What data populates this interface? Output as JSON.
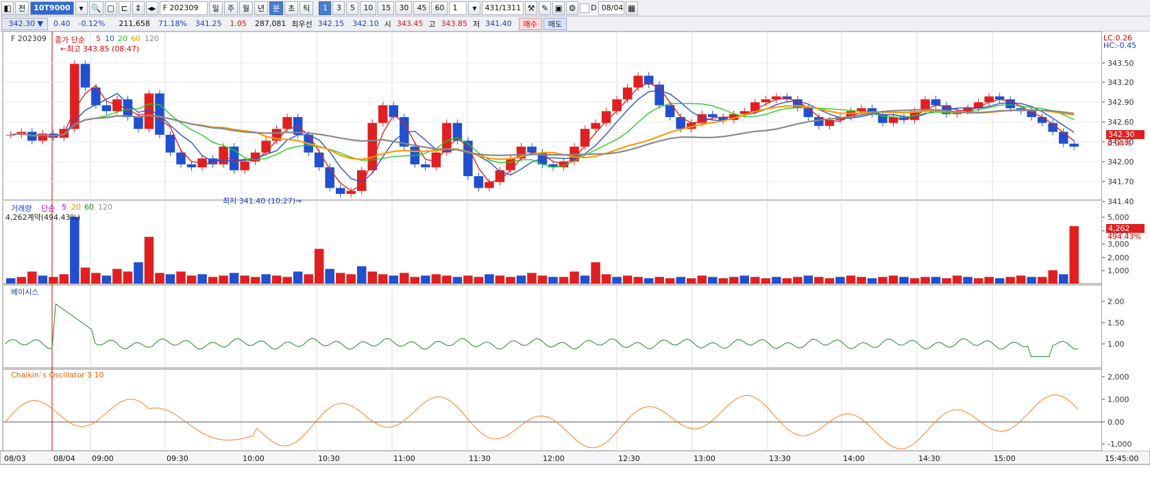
{
  "toolbar": {
    "items": [
      "◧",
      "전",
      "10T9000",
      "▾",
      "🔍",
      "",
      "",
      "",
      "◂▸",
      "F 202309",
      "일",
      "주",
      "월",
      "년",
      "분",
      "초",
      "틱",
      "1",
      "3",
      "5",
      "10",
      "15",
      "30",
      "45",
      "60",
      "1",
      "▾",
      "431",
      "/1311",
      "",
      "",
      "",
      "⚙",
      "",
      "D",
      "08/04",
      ""
    ],
    "selected_interval": "1",
    "code": "10T9000",
    "contract": "F 202309",
    "count": "431",
    "total": "/1311",
    "date": "08/04"
  },
  "quote": {
    "price": "342.30 ▼",
    "change": "0.40",
    "change_pct": "-0.12%",
    "volume": "211,658",
    "vol_ratio": "71.18%",
    "p1": "341.25",
    "p1_chg": "1.05",
    "open_int": "287,081",
    "best_label": "최우선",
    "best1": "342.15",
    "best2": "342.10",
    "open_label": "시",
    "open": "343.45",
    "high_label": "고",
    "high": "343.85",
    "low_label": "저",
    "low": "341.40",
    "buy": "매수",
    "sell": "매도"
  },
  "price_panel": {
    "symbol": "F 202309",
    "ma_label": "종가 단순",
    "ma_periods": [
      "5",
      "10",
      "20",
      "60",
      "120"
    ],
    "ma_colors": [
      "#e02020",
      "#2a4fd0",
      "#22cc22",
      "#ff9a00",
      "#888888"
    ],
    "high_marker": "최고 343.85 (08:47)",
    "low_marker": "최저 341.40 (10:27)",
    "lc": "LC:0.26",
    "hc": "HC:-0.45",
    "current": "342.30",
    "current_pct": "0.04%",
    "y_ticks": [
      "343.50",
      "343.20",
      "342.90",
      "342.60",
      "342.30",
      "342.00",
      "341.70",
      "341.40"
    ]
  },
  "volume_panel": {
    "title": "거래량",
    "ma_label": "단순",
    "ma_periods": [
      "5",
      "20",
      "60",
      "120"
    ],
    "value_label": "4,262계약(494.43%)",
    "current": "4,262",
    "current_pct": "494.43%",
    "y_ticks": [
      "5,000",
      "4,000",
      "3,000",
      "2,000",
      "1,000"
    ]
  },
  "basis_panel": {
    "title": "베이시스",
    "y_ticks": [
      "2.00",
      "1.50",
      "1.00"
    ]
  },
  "osc_panel": {
    "title": "Chaikin`s Oscillator 3 10",
    "y_ticks": [
      "2,000",
      "1,000",
      "0.00",
      "-1,000"
    ]
  },
  "time_axis": [
    "08/03",
    "08/04",
    "09:00",
    "09:30",
    "10:00",
    "10:30",
    "11:00",
    "11:30",
    "12:00",
    "12:30",
    "13:00",
    "13:30",
    "14:00",
    "14:30",
    "15:00",
    "15:45:00"
  ],
  "colors": {
    "up": "#e02020",
    "down": "#2050d0",
    "basis": "#1a8a1a",
    "osc": "#ff7a1a"
  }
}
